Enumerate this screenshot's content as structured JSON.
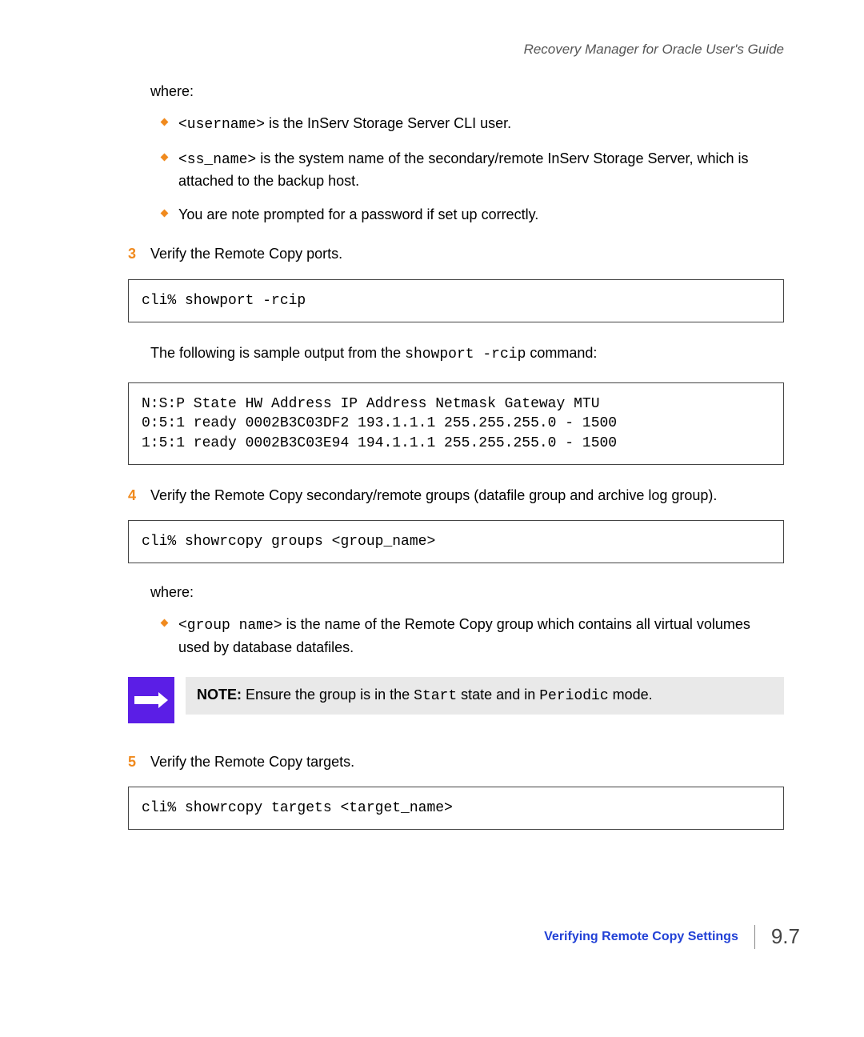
{
  "header": {
    "guide_title": "Recovery Manager for Oracle User's Guide"
  },
  "intro_where": "where:",
  "bullets1": [
    {
      "pretext": "<username>",
      "posttext": " is the InServ Storage Server CLI user."
    },
    {
      "pretext": "<ss_name>",
      "posttext": " is the system name of the secondary/remote InServ Storage Server, which is attached to the backup host."
    },
    {
      "plain": "You are note prompted for a password if set up correctly."
    }
  ],
  "step3": {
    "num": "3",
    "text": "Verify the Remote Copy ports."
  },
  "code1": "cli% showport -rcip",
  "sample_intro_pre": "The following is sample output from the ",
  "sample_intro_cmd": "showport -rcip",
  "sample_intro_post": " command:",
  "code2": "N:S:P State HW Address IP Address Netmask Gateway MTU\n0:5:1 ready 0002B3C03DF2 193.1.1.1 255.255.255.0 - 1500\n1:5:1 ready 0002B3C03E94 194.1.1.1 255.255.255.0 - 1500",
  "step4": {
    "num": "4",
    "text": "Verify the Remote Copy secondary/remote groups (datafile group and archive log group)."
  },
  "code3": "cli% showrcopy groups <group_name>",
  "where2": "where:",
  "bullets2": [
    {
      "pretext": "<group name>",
      "posttext": " is the name of the Remote Copy group which contains all virtual volumes used by database datafiles."
    }
  ],
  "note": {
    "label": "NOTE:",
    "t1": " Ensure the group is in the ",
    "m1": "Start",
    "t2": " state and in ",
    "m2": "Periodic",
    "t3": " mode."
  },
  "step5": {
    "num": "5",
    "text": "Verify the Remote Copy targets."
  },
  "code4": "cli% showrcopy targets <target_name>",
  "footer": {
    "section": "Verifying Remote Copy Settings",
    "page": "9.7"
  }
}
